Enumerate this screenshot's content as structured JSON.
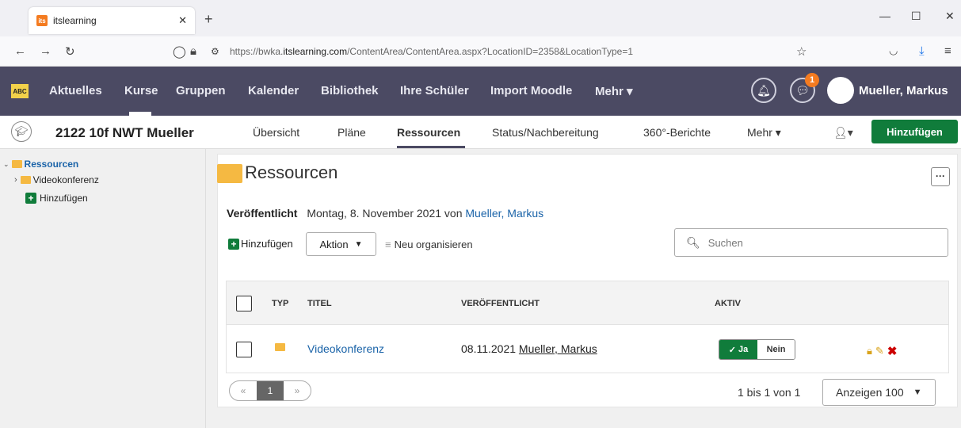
{
  "browser": {
    "tab_title": "itslearning",
    "favicon_text": "its",
    "new_tab": "+",
    "url_prefix": "https://bwka.",
    "url_host": "itslearning.com",
    "url_path": "/ContentArea/ContentArea.aspx?LocationID=2358&LocationType=1"
  },
  "appnav": {
    "logo_text": "ABC",
    "items": [
      "Aktuelles",
      "Kurse",
      "Gruppen",
      "Kalender",
      "Bibliothek",
      "Ihre Schüler",
      "Import Moodle",
      "Mehr ▾"
    ],
    "notification_count": "1",
    "user": "Mueller, Markus"
  },
  "course": {
    "title": "2122 10f NWT Mueller",
    "tabs": [
      "Übersicht",
      "Pläne",
      "Ressourcen",
      "Status/Nachbereitung",
      "360°-Berichte",
      "Mehr ▾"
    ],
    "active_tab": "Ressourcen",
    "add_button": "Hinzufügen"
  },
  "sidebar": {
    "root": "Ressourcen",
    "child": "Videokonferenz",
    "add": "Hinzufügen"
  },
  "main": {
    "title": "Ressourcen",
    "published_label": "Veröffentlicht",
    "published_text": "Montag, 8. November 2021 von",
    "published_author": "Mueller, Markus",
    "add_label": "Hinzufügen",
    "action_label": "Aktion",
    "reorganize_label": "Neu organisieren",
    "search_placeholder": "Suchen"
  },
  "table": {
    "headers": {
      "type": "TYP",
      "title": "TITEL",
      "published": "VERÖFFENTLICHT",
      "active": "AKTIV"
    },
    "rows": [
      {
        "title": "Videokonferenz",
        "date": "08.11.2021",
        "author": "Mueller, Markus",
        "yes": "Ja",
        "no": "Nein"
      }
    ]
  },
  "footer": {
    "prev": "«",
    "page": "1",
    "next": "»",
    "count_text": "1 bis 1 von 1",
    "show_label": "Anzeigen 100"
  },
  "colors": {
    "nav_bg": "#4b4a63",
    "accent_green": "#107c3b",
    "link": "#1a63a8",
    "folder": "#f5b942",
    "badge": "#f47b20"
  }
}
